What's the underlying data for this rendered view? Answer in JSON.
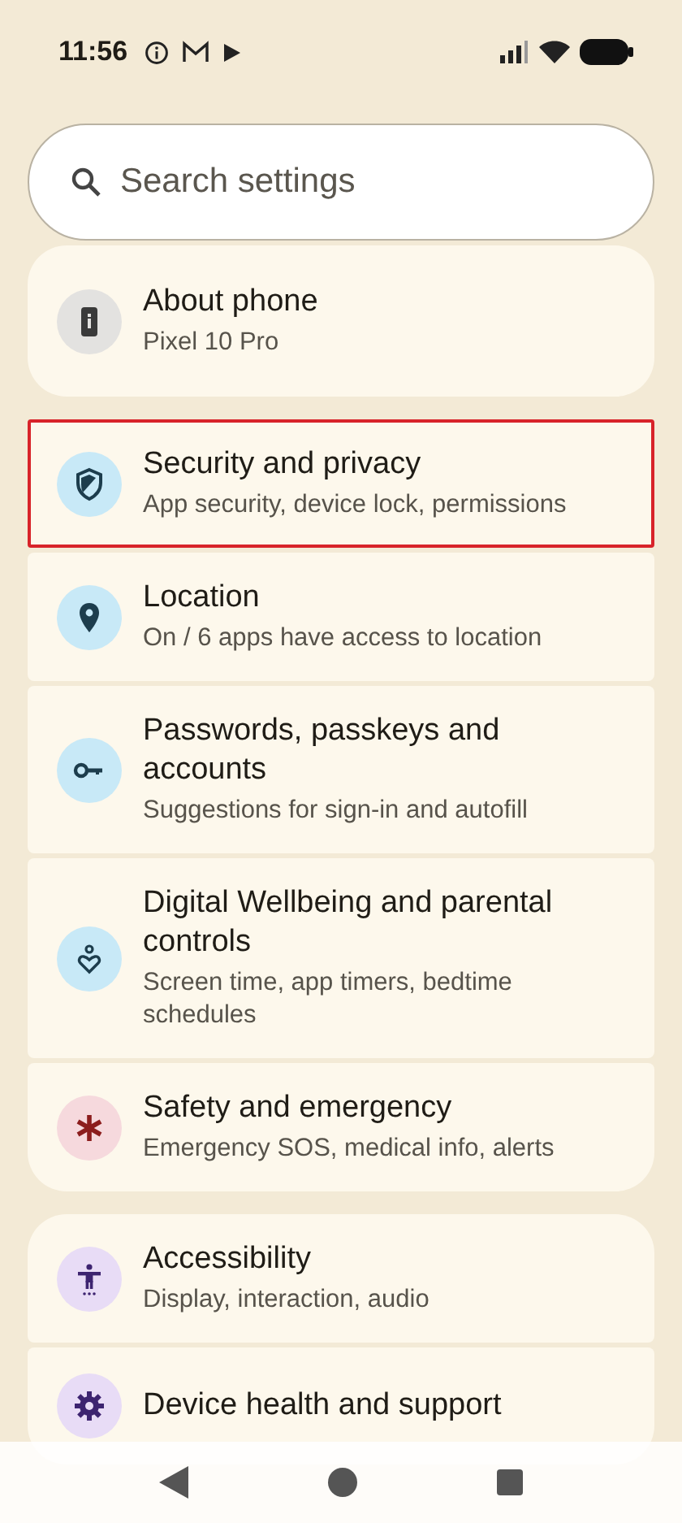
{
  "status_bar": {
    "time": "11:56"
  },
  "search": {
    "placeholder": "Search settings"
  },
  "groups": [
    {
      "items": [
        {
          "kind": "info",
          "title": "About phone",
          "subtitle": "Pixel 10 Pro",
          "selected": false
        }
      ]
    },
    {
      "items": [
        {
          "kind": "shield",
          "title": "Security and privacy",
          "subtitle": "App security, device lock, permissions",
          "selected": true
        },
        {
          "kind": "pin",
          "title": "Location",
          "subtitle": "On / 6 apps have access to location",
          "selected": false
        },
        {
          "kind": "key",
          "title": "Passwords, passkeys and accounts",
          "subtitle": "Suggestions for sign-in and autofill",
          "selected": false
        },
        {
          "kind": "wellbeing",
          "title": "Digital Wellbeing and parental controls",
          "subtitle": "Screen time, app timers, bedtime schedules",
          "selected": false
        },
        {
          "kind": "asterisk",
          "title": "Safety and emergency",
          "subtitle": "Emergency SOS, medical info, alerts",
          "selected": false
        }
      ]
    },
    {
      "items": [
        {
          "kind": "accessibility",
          "title": "Accessibility",
          "subtitle": "Display, interaction, audio",
          "selected": false
        },
        {
          "kind": "gear",
          "title": "Device health and support",
          "selected": false
        }
      ]
    }
  ]
}
